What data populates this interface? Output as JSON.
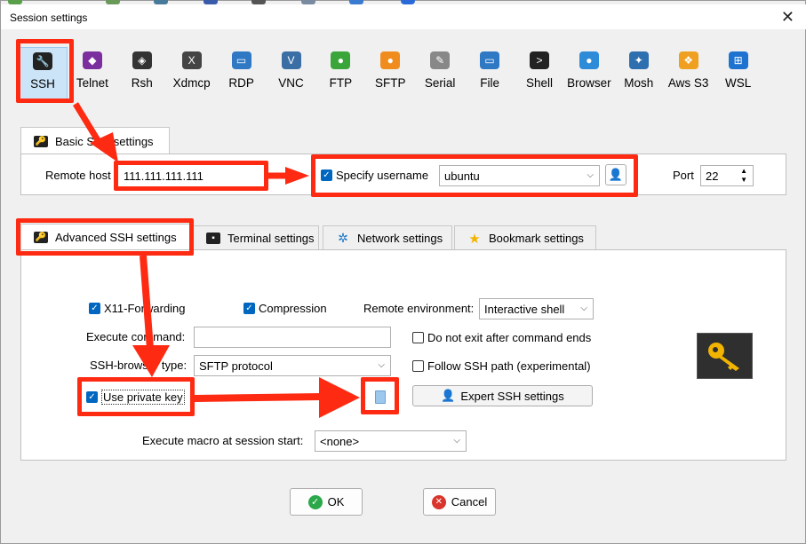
{
  "window": {
    "title": "Session settings"
  },
  "protocols": [
    {
      "label": "SSH",
      "icon": "ssh-key-icon",
      "color": "#222222",
      "active": true
    },
    {
      "label": "Telnet",
      "icon": "telnet-gem-icon",
      "color": "#7b2f9e"
    },
    {
      "label": "Rsh",
      "icon": "rsh-icon",
      "color": "#333333"
    },
    {
      "label": "Xdmcp",
      "icon": "xdmcp-x-icon",
      "color": "#444444"
    },
    {
      "label": "RDP",
      "icon": "rdp-monitor-icon",
      "color": "#2f78c4"
    },
    {
      "label": "VNC",
      "icon": "vnc-icon",
      "color": "#3a6ea5"
    },
    {
      "label": "FTP",
      "icon": "ftp-globe-icon",
      "color": "#3aa63a"
    },
    {
      "label": "SFTP",
      "icon": "sftp-globe-icon",
      "color": "#f08c1e"
    },
    {
      "label": "Serial",
      "icon": "serial-plug-icon",
      "color": "#888888"
    },
    {
      "label": "File",
      "icon": "file-monitor-icon",
      "color": "#2f78c4"
    },
    {
      "label": "Shell",
      "icon": "shell-terminal-icon",
      "color": "#222222"
    },
    {
      "label": "Browser",
      "icon": "browser-globe-icon",
      "color": "#2e8bd8"
    },
    {
      "label": "Mosh",
      "icon": "mosh-satellite-icon",
      "color": "#2e6fb0"
    },
    {
      "label": "Aws S3",
      "icon": "aws-cubes-icon",
      "color": "#f0a020"
    },
    {
      "label": "WSL",
      "icon": "windows-logo-icon",
      "color": "#1e73d0"
    }
  ],
  "basic": {
    "tab_label": "Basic SSH settings",
    "remote_host_label": "Remote host",
    "remote_host_value": "111.111.111.111",
    "specify_username_label": "Specify username",
    "specify_username_checked": true,
    "username_value": "ubuntu",
    "port_label": "Port",
    "port_value": "22"
  },
  "tabs": [
    {
      "label": "Advanced SSH settings",
      "active": true
    },
    {
      "label": "Terminal settings"
    },
    {
      "label": "Network settings"
    },
    {
      "label": "Bookmark settings"
    }
  ],
  "advanced": {
    "x11_label": "X11-Forwarding",
    "compression_label": "Compression",
    "remote_env_label": "Remote environment:",
    "remote_env_value": "Interactive shell",
    "execute_command_label": "Execute command:",
    "execute_command_value": "",
    "do_not_exit_label": "Do not exit after command ends",
    "browser_type_label": "SSH-browser type:",
    "browser_type_value": "SFTP protocol",
    "follow_ssh_path_label": "Follow SSH path (experimental)",
    "use_private_key_label": "Use private key",
    "private_key_path": "",
    "expert_label": "Expert SSH settings",
    "macro_label": "Execute macro at session start:",
    "macro_value": "<none>"
  },
  "buttons": {
    "ok": "OK",
    "cancel": "Cancel"
  },
  "colors": {
    "annotation_red": "#ff2a12",
    "checkbox_blue": "#0067c0",
    "key_yellow": "#f2b400"
  }
}
